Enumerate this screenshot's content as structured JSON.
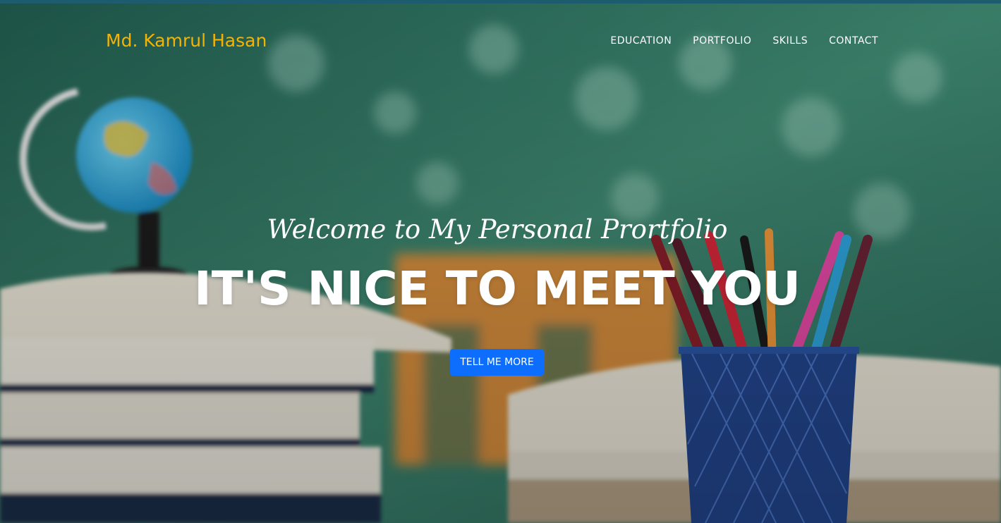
{
  "colors": {
    "brand": "#f5b301",
    "accent": "#0d6efd",
    "nav_text": "#ffffff"
  },
  "header": {
    "brand": "Md. Kamrul Hasan",
    "nav": [
      {
        "label": "EDUCATION"
      },
      {
        "label": "PORTFOLIO"
      },
      {
        "label": "SKILLS"
      },
      {
        "label": "CONTACT"
      }
    ]
  },
  "hero": {
    "subtitle": "Welcome to My Personal Prortfolio",
    "title": "IT'S NICE TO MEET YOU",
    "button_label": "TELL ME MORE",
    "background": "classroom desk with globe, books and pencil holder"
  }
}
